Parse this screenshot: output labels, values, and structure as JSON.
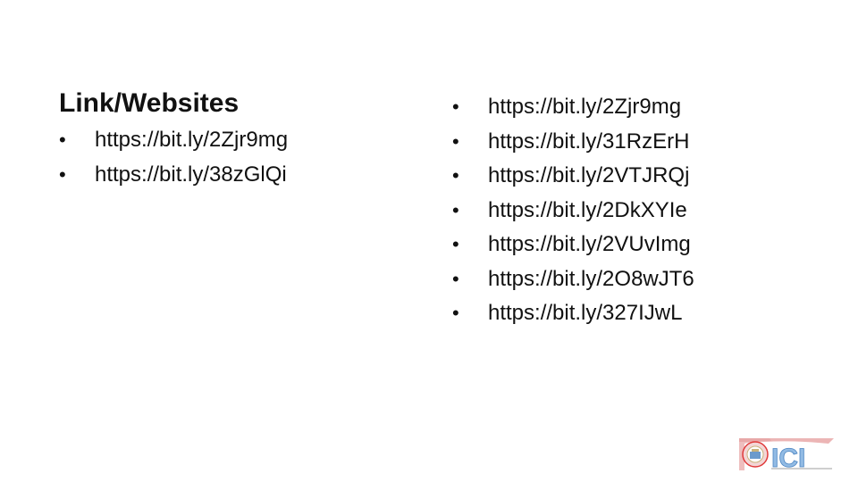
{
  "left": {
    "heading": "Link/Websites",
    "links": [
      "https://bit.ly/2Zjr9mg",
      "https://bit.ly/38zGlQi"
    ]
  },
  "right": {
    "links": [
      "https://bit.ly/2Zjr9mg",
      "https://bit.ly/31RzErH",
      "https://bit.ly/2VTJRQj",
      "https://bit.ly/2DkXYIe",
      "https://bit.ly/2VUvImg",
      "https://bit.ly/2O8wJT6",
      "https://bit.ly/327IJwL"
    ]
  },
  "logo": {
    "text": "ICI",
    "icon": "ici-logo"
  },
  "colors": {
    "text": "#111111",
    "logo_red": "#e03a3a",
    "logo_blue": "#2c6fb7",
    "logo_grey": "#cfcfcf"
  }
}
